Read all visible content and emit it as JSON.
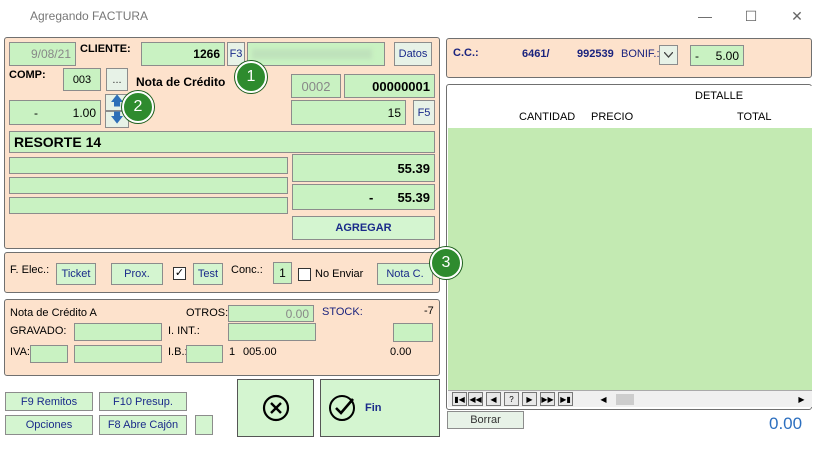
{
  "window": {
    "title": "Agregando FACTURA",
    "min": "—",
    "max": "☐",
    "close": "✕"
  },
  "top": {
    "date": "9/08/21",
    "cliente_label": "CLIENTE:",
    "cliente_code": "1266",
    "f3": "F3",
    "datos": "Datos",
    "comp_label": "COMP:",
    "comp_code": "003",
    "ellipsis": "...",
    "doc_type": "Nota de Crédito",
    "punto_venta": "0002",
    "numero": "00000001",
    "qty_sign": "-",
    "qty": "1.00",
    "code": "15",
    "f5": "F5",
    "product": "RESORTE 14",
    "price1": "55.39",
    "price2_sign": "-",
    "price2": "55.39",
    "agregar": "AGREGAR"
  },
  "felec": {
    "label": "F. Elec.:",
    "ticket": "Ticket",
    "prox": "Prox.",
    "test": "Test",
    "conc_label": "Conc.:",
    "conc_value": "1",
    "no_enviar": "No Enviar",
    "nota_c": "Nota C."
  },
  "totals": {
    "doc_name": "Nota de Crédito A",
    "otros_label": "OTROS:",
    "otros_value": "0.00",
    "stock_label": "STOCK:",
    "stock_value": "-7",
    "gravado_label": "GRAVADO:",
    "iint_label": "I. INT.:",
    "iva_label": "IVA:",
    "ib_label": "I.B.:",
    "ib_1": "1",
    "ib_2": "005.00",
    "ib_3": "0.00"
  },
  "bottom": {
    "f9": "F9 Remitos",
    "f10": "F10 Presup.",
    "opciones": "Opciones",
    "f8": "F8 Abre Cajón",
    "fin": "Fin"
  },
  "right": {
    "cc_label": "C.C.:",
    "cc_a": "6461/",
    "cc_b": "992539",
    "bonif_label": "BONIF.:",
    "bonif_sign": "-",
    "bonif_value": "5.00",
    "detalle": "DETALLE",
    "col_cantidad": "CANTIDAD",
    "col_precio": "PRECIO",
    "col_total": "TOTAL",
    "borrar": "Borrar",
    "grand_total": "0.00"
  },
  "badges": [
    "1",
    "2",
    "3"
  ]
}
